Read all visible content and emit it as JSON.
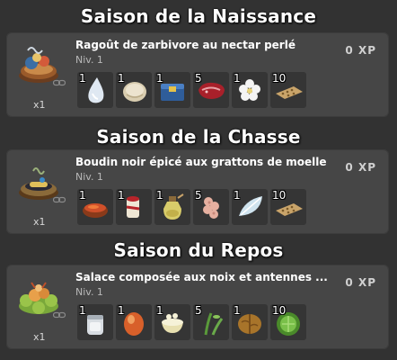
{
  "seasons": [
    {
      "title": "Saison de la Naissance",
      "recipe": "Ragoût de zarbivore au nectar perlé",
      "level": "Niv. 1",
      "xp": "0 XP",
      "quantity": "x1",
      "ingredients": [
        {
          "qty": "1",
          "icon": "white-drop-icon"
        },
        {
          "qty": "1",
          "icon": "pearl-shell-icon"
        },
        {
          "qty": "1",
          "icon": "blue-box-icon"
        },
        {
          "qty": "5",
          "icon": "raw-meat-icon"
        },
        {
          "qty": "1",
          "icon": "white-flower-icon"
        },
        {
          "qty": "10",
          "icon": "seed-tray-icon"
        }
      ]
    },
    {
      "title": "Saison de la Chasse",
      "recipe": "Boudin noir épicé aux grattons de moelle",
      "level": "Niv. 1",
      "xp": "0 XP",
      "quantity": "x1",
      "ingredients": [
        {
          "qty": "1",
          "icon": "spice-bowl-icon"
        },
        {
          "qty": "1",
          "icon": "marrow-bone-icon"
        },
        {
          "qty": "1",
          "icon": "potion-jar-icon"
        },
        {
          "qty": "5",
          "icon": "pink-root-icon"
        },
        {
          "qty": "1",
          "icon": "white-drop-icon"
        },
        {
          "qty": "10",
          "icon": "seed-tray-icon"
        }
      ]
    },
    {
      "title": "Saison du Repos",
      "recipe": "Salace composée aux noix et antennes ...",
      "level": "Niv. 1",
      "xp": "0 XP",
      "quantity": "x1",
      "ingredients": [
        {
          "qty": "1",
          "icon": "salt-jar-icon"
        },
        {
          "qty": "1",
          "icon": "orange-egg-icon"
        },
        {
          "qty": "1",
          "icon": "cream-bowl-icon"
        },
        {
          "qty": "5",
          "icon": "green-sprout-icon"
        },
        {
          "qty": "1",
          "icon": "walnut-icon"
        },
        {
          "qty": "10",
          "icon": "cabbage-icon"
        }
      ]
    }
  ]
}
